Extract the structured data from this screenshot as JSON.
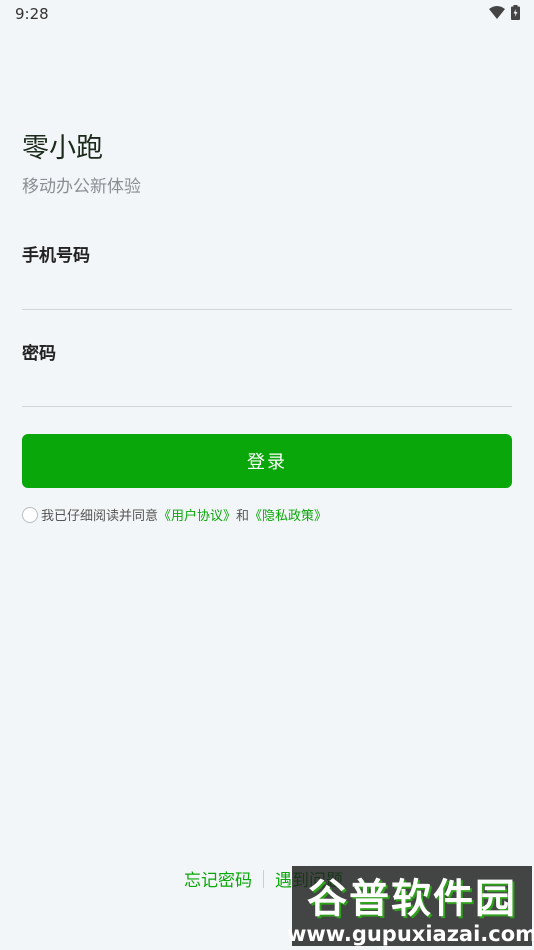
{
  "status_bar": {
    "time": "9:28"
  },
  "app": {
    "title": "零小跑",
    "subtitle": "移动办公新体验"
  },
  "form": {
    "phone_label": "手机号码",
    "phone_value": "",
    "phone_placeholder": "",
    "password_label": "密码",
    "password_value": "",
    "password_placeholder": ""
  },
  "login_button": "登录",
  "agreement": {
    "prefix": "我已仔细阅读并同意",
    "user_agreement": "《用户协议》",
    "and": "和",
    "privacy_policy": "《隐私政策》"
  },
  "bottom_links": {
    "forgot_password": "忘记密码",
    "problems": "遇到问题"
  },
  "watermark": {
    "main": "谷普软件园",
    "url": "www.gupuxiazai.com"
  },
  "colors": {
    "accent": "#0aa70a",
    "background": "#f3f6f8"
  },
  "icons": [
    "wifi-icon",
    "battery-icon"
  ]
}
